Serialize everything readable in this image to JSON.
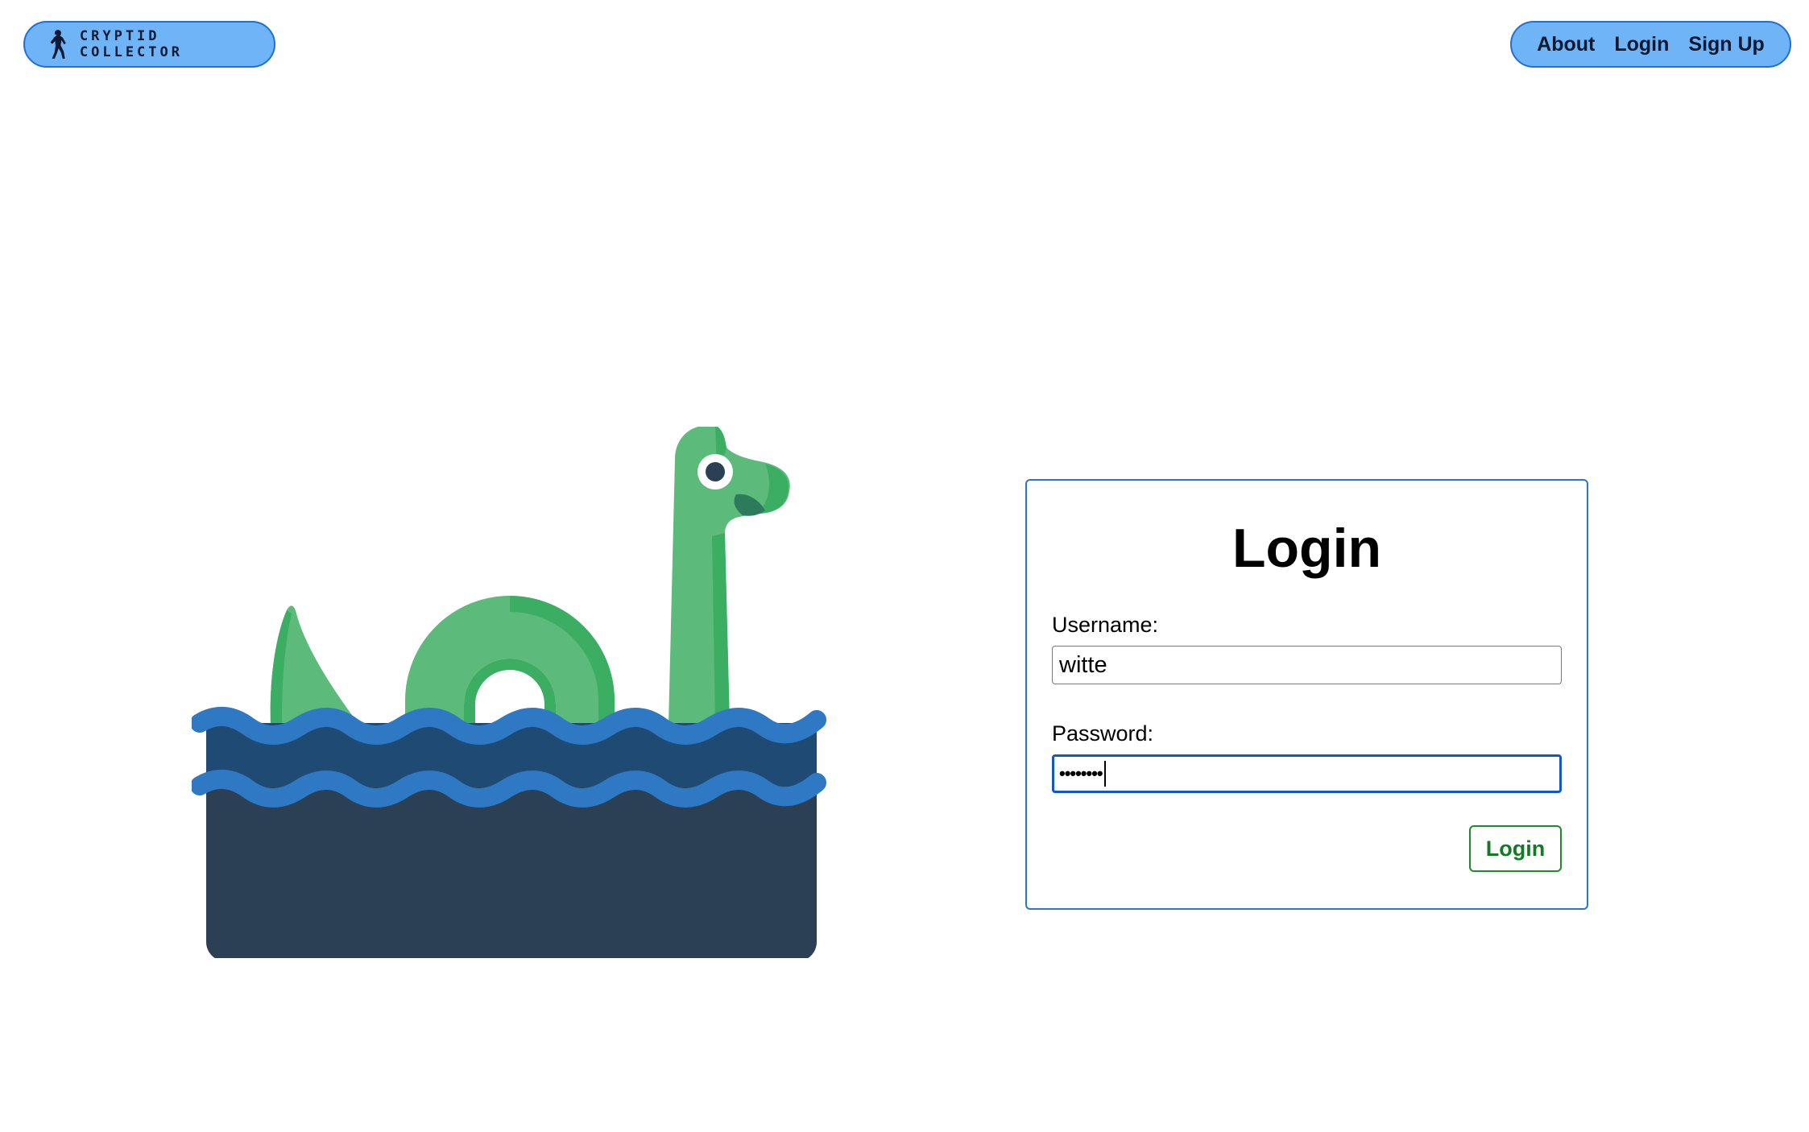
{
  "header": {
    "brand": {
      "icon": "bigfoot-icon",
      "title": "CRYPTID COLLECTOR"
    },
    "nav": [
      {
        "label": "About"
      },
      {
        "label": "Login"
      },
      {
        "label": "Sign Up"
      }
    ],
    "colors": {
      "pill_fill": "#6fb4f7",
      "pill_border": "#1f6fd6"
    }
  },
  "illustration": {
    "subject": "loch-ness-monster-icon",
    "colors": {
      "body": "#5cbb7a",
      "body_shade": "#3cae63",
      "wave": "#2f78c4",
      "water_top": "#1e4a73",
      "water_deep": "#2b3f55"
    }
  },
  "login_form": {
    "title": "Login",
    "username": {
      "label": "Username:",
      "value": "witte"
    },
    "password": {
      "label": "Password:",
      "masked_value": "••••••••"
    },
    "submit_label": "Login",
    "colors": {
      "card_border": "#2a75d3",
      "focus_border": "#1357c4",
      "submit_text": "#137a25",
      "submit_border": "#1d8a2e"
    }
  }
}
